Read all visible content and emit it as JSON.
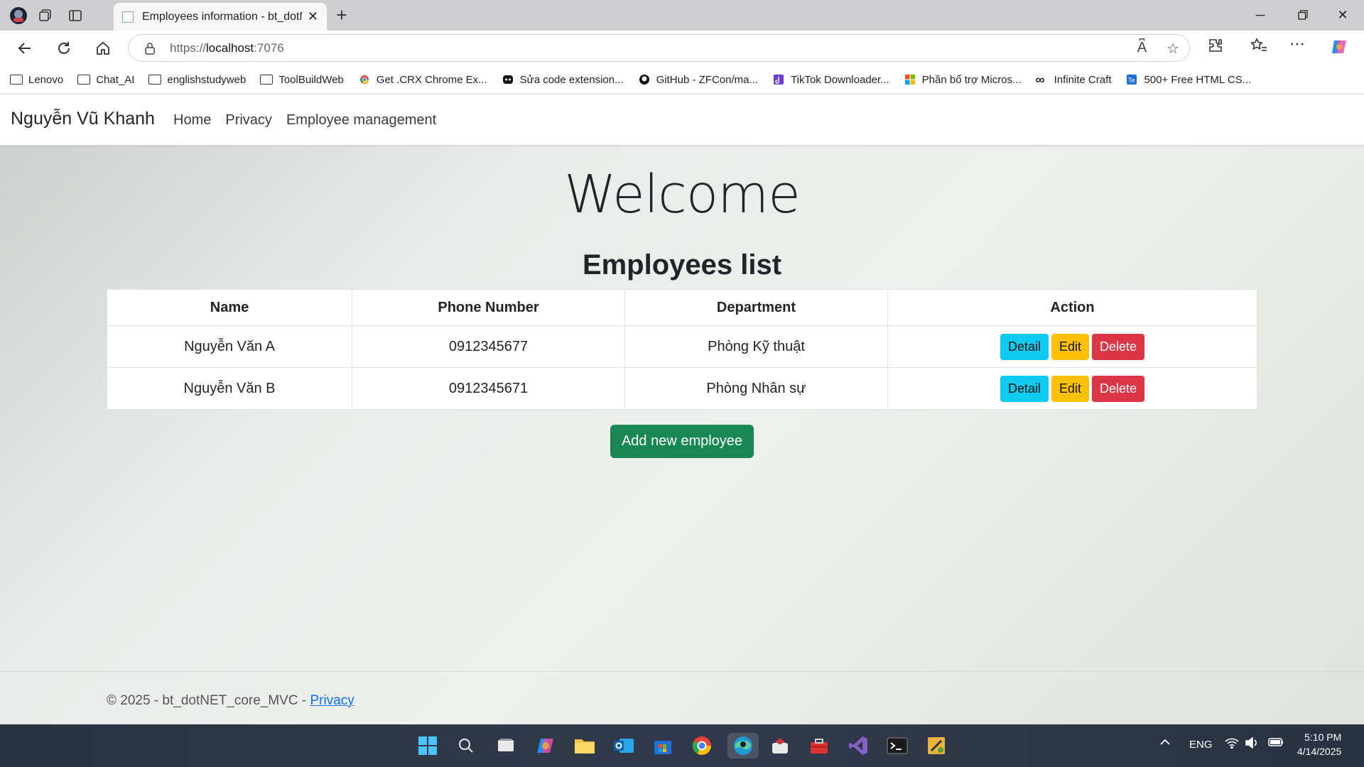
{
  "browser": {
    "tab_title": "Employees information - bt_dotNET_core_MVC",
    "url_prefix": "https://",
    "url_host": "localhost",
    "url_rest": ":7076",
    "bookmarks": [
      {
        "label": "Lenovo",
        "icon": "folder-icon"
      },
      {
        "label": "Chat_AI",
        "icon": "folder-icon"
      },
      {
        "label": "englishstudyweb",
        "icon": "folder-icon"
      },
      {
        "label": "ToolBuildWeb",
        "icon": "folder-icon"
      },
      {
        "label": "Get .CRX Chrome Ex...",
        "icon": "chrome-icon"
      },
      {
        "label": "Sửa code extension...",
        "icon": "discord-icon"
      },
      {
        "label": "GitHub - ZFCon/ma...",
        "icon": "github-icon"
      },
      {
        "label": "TikTok Downloader...",
        "icon": "tiktok-icon"
      },
      {
        "label": "Phần bổ trợ Micros...",
        "icon": "microsoft-icon"
      },
      {
        "label": "Infinite Craft",
        "icon": "infinity-icon"
      },
      {
        "label": "500+ Free HTML CS...",
        "icon": "te-icon"
      }
    ]
  },
  "site": {
    "brand": "Nguyễn Vũ Khanh",
    "nav": [
      "Home",
      "Privacy",
      "Employee management"
    ],
    "welcome": "Welcome",
    "list_title": "Employees list",
    "columns": [
      "Name",
      "Phone Number",
      "Department",
      "Action"
    ],
    "rows": [
      {
        "name": "Nguyễn Văn A",
        "phone": "0912345677",
        "department": "Phòng Kỹ thuật"
      },
      {
        "name": "Nguyễn Văn B",
        "phone": "0912345671",
        "department": "Phòng Nhân sự"
      }
    ],
    "actions": {
      "detail": "Detail",
      "edit": "Edit",
      "delete": "Delete"
    },
    "add_button": "Add new employee",
    "footer_text": "© 2025 - bt_dotNET_core_MVC - ",
    "footer_link": "Privacy"
  },
  "taskbar": {
    "lang": "ENG",
    "time": "5:10 PM",
    "date": "4/14/2025"
  },
  "colors": {
    "info": "#0dcaf0",
    "warning": "#ffc107",
    "danger": "#dc3545",
    "success": "#198754"
  }
}
